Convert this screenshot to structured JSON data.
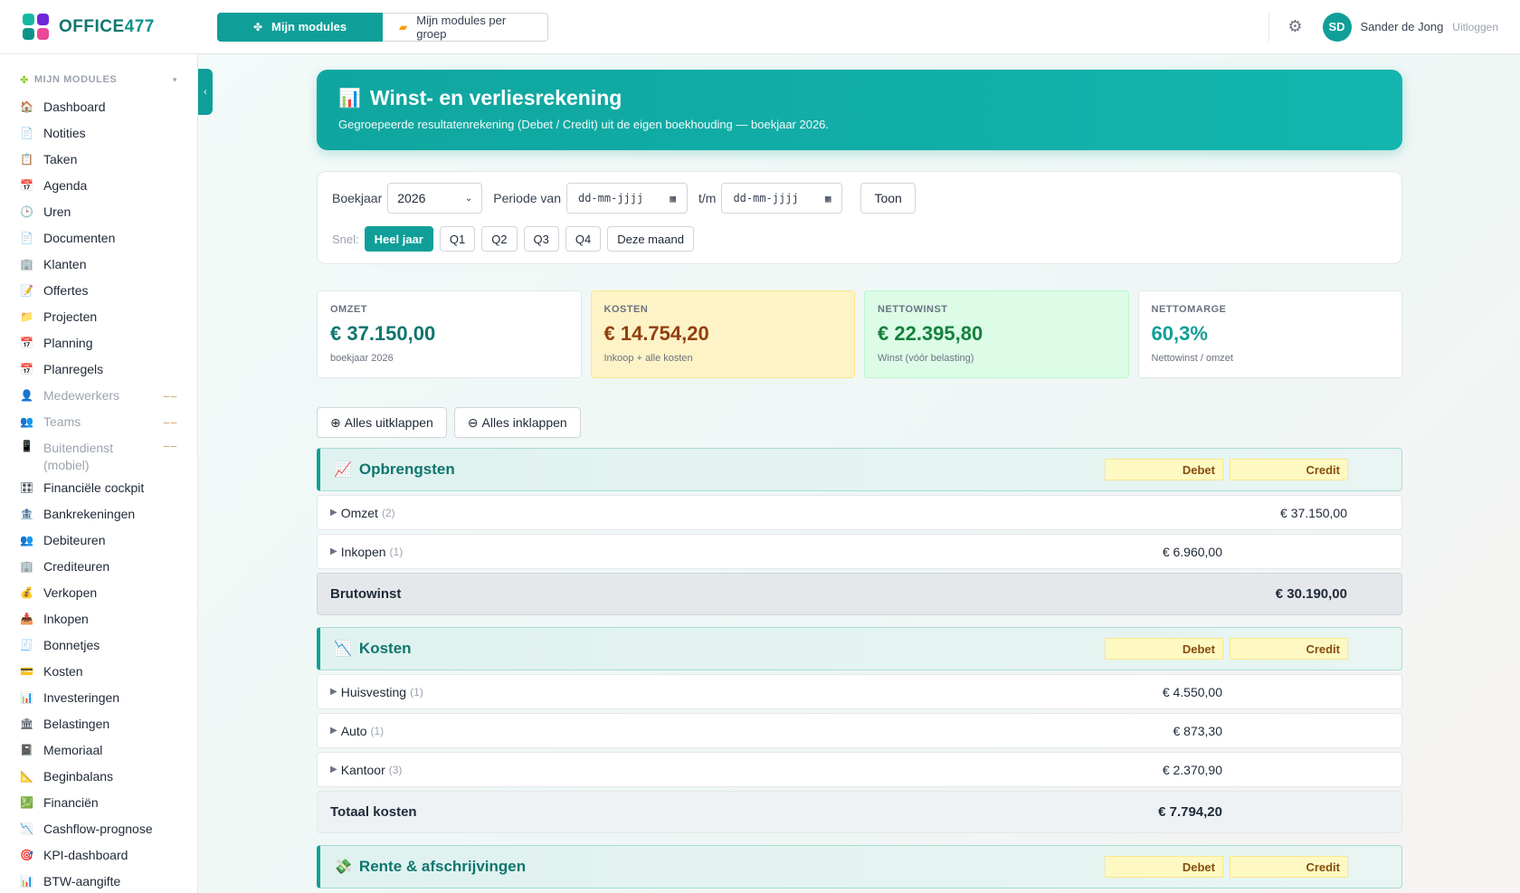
{
  "brand": {
    "name": "OFFICE",
    "number": "477"
  },
  "top_tabs": [
    {
      "label": "Mijn modules",
      "icon": "puzzle-icon"
    },
    {
      "label": "Mijn modules per groep",
      "icon": "folder-icon"
    }
  ],
  "user": {
    "initials": "SD",
    "name": "Sander de Jong",
    "logout": "Uitloggen"
  },
  "sidebar": {
    "heading": "MIJN MODULES",
    "items": [
      {
        "label": "Dashboard",
        "icon": "🏠"
      },
      {
        "label": "Notities",
        "icon": "📄"
      },
      {
        "label": "Taken",
        "icon": "📋"
      },
      {
        "label": "Agenda",
        "icon": "📅"
      },
      {
        "label": "Uren",
        "icon": "🕒"
      },
      {
        "label": "Documenten",
        "icon": "📄"
      },
      {
        "label": "Klanten",
        "icon": "🏢"
      },
      {
        "label": "Offertes",
        "icon": "📝"
      },
      {
        "label": "Projecten",
        "icon": "📁"
      },
      {
        "label": "Planning",
        "icon": "📅"
      },
      {
        "label": "Planregels",
        "icon": "📅"
      },
      {
        "label": "Medewerkers",
        "icon": "👤"
      },
      {
        "label": "Teams",
        "icon": "👥"
      },
      {
        "label": "Buitendienst (mobiel)",
        "icon": "📱"
      },
      {
        "label": "Financiële cockpit",
        "icon": "🎛"
      },
      {
        "label": "Bankrekeningen",
        "icon": "🏦"
      },
      {
        "label": "Debiteuren",
        "icon": "👥"
      },
      {
        "label": "Crediteuren",
        "icon": "🏢"
      },
      {
        "label": "Verkopen",
        "icon": "💰"
      },
      {
        "label": "Inkopen",
        "icon": "📥"
      },
      {
        "label": "Bonnetjes",
        "icon": "🧾"
      },
      {
        "label": "Kosten",
        "icon": "💳"
      },
      {
        "label": "Investeringen",
        "icon": "📊"
      },
      {
        "label": "Belastingen",
        "icon": "🏛"
      },
      {
        "label": "Memoriaal",
        "icon": "📓"
      },
      {
        "label": "Beginbalans",
        "icon": "📐"
      },
      {
        "label": "Financiën",
        "icon": "💹"
      },
      {
        "label": "Cashflow-prognose",
        "icon": "📉"
      },
      {
        "label": "KPI-dashboard",
        "icon": "🎯"
      },
      {
        "label": "BTW-aangifte",
        "icon": "📊"
      }
    ]
  },
  "hero": {
    "icon": "📊",
    "title": "Winst- en verliesrekening",
    "subtitle": "Gegroepeerde resultatenrekening (Debet / Credit) uit de eigen boekhouding — boekjaar 2026."
  },
  "filter": {
    "boekjaar_label": "Boekjaar",
    "boekjaar_value": "2026",
    "periode_label": "Periode van",
    "date_placeholder": "dd-mm-jjjj",
    "tm_label": "t/m",
    "toon_label": "Toon",
    "snel_label": "Snel:",
    "quick": [
      "Heel jaar",
      "Q1",
      "Q2",
      "Q3",
      "Q4",
      "Deze maand"
    ]
  },
  "kpis": [
    {
      "label": "OMZET",
      "value": "€ 37.150,00",
      "sub": "boekjaar 2026"
    },
    {
      "label": "KOSTEN",
      "value": "€ 14.754,20",
      "sub": "Inkoop + alle kosten"
    },
    {
      "label": "NETTOWINST",
      "value": "€ 22.395,80",
      "sub": "Winst (vóór belasting)"
    },
    {
      "label": "NETTOMARGE",
      "value": "60,3%",
      "sub": "Nettowinst / omzet"
    }
  ],
  "actions": {
    "expand": "Alles uitklappen",
    "collapse": "Alles inklappen"
  },
  "columns": {
    "debet": "Debet",
    "credit": "Credit"
  },
  "sections": [
    {
      "title": "Opbrengsten",
      "icon": "📈",
      "rows": [
        {
          "label": "Omzet",
          "count": "(2)",
          "debet": "",
          "credit": "€ 37.150,00"
        },
        {
          "label": "Inkopen",
          "count": "(1)",
          "debet": "€ 6.960,00",
          "credit": ""
        }
      ],
      "total": {
        "label": "Brutowinst",
        "debet": "",
        "credit": "€ 30.190,00"
      }
    },
    {
      "title": "Kosten",
      "icon": "📉",
      "rows": [
        {
          "label": "Huisvesting",
          "count": "(1)",
          "debet": "€ 4.550,00",
          "credit": ""
        },
        {
          "label": "Auto",
          "count": "(1)",
          "debet": "€ 873,30",
          "credit": ""
        },
        {
          "label": "Kantoor",
          "count": "(3)",
          "debet": "€ 2.370,90",
          "credit": ""
        }
      ],
      "total": {
        "label": "Totaal kosten",
        "debet": "€ 7.794,20",
        "credit": ""
      }
    },
    {
      "title": "Rente & afschrijvingen",
      "icon": "💸"
    }
  ]
}
